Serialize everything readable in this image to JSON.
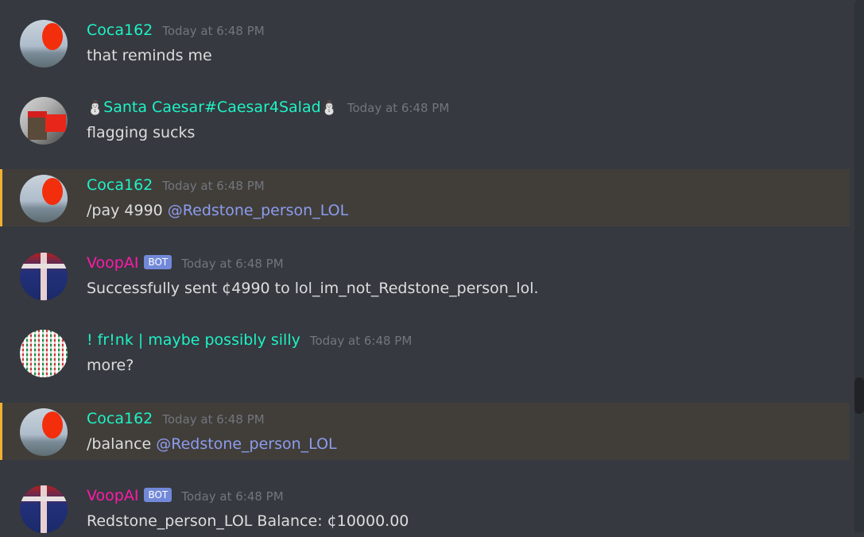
{
  "messages": [
    {
      "author": "Coca162",
      "time": "Today at 6:48 PM",
      "text": "that reminds me",
      "avatar": "coca",
      "highlight": false
    },
    {
      "author": "Santa Caesar#Caesar4Salad",
      "author_prefix": "⛄",
      "author_suffix": "⛄",
      "time": "Today at 6:48 PM",
      "text": "flagging sucks",
      "avatar": "santa",
      "highlight": false
    },
    {
      "author": "Coca162",
      "time": "Today at 6:48 PM",
      "text": "/pay 4990 ",
      "mention": "@Redstone_person_LOL",
      "avatar": "coca",
      "highlight": true
    },
    {
      "author": "VoopAI",
      "badge": "BOT",
      "time": "Today at 6:48 PM",
      "text": "Successfully sent ¢4990 to lol_im_not_Redstone_person_lol.",
      "avatar": "voop",
      "highlight": false
    },
    {
      "author": "! fr!nk | maybe possibly silly",
      "time": "Today at 6:48 PM",
      "text": "more?",
      "avatar": "frink",
      "highlight": false
    },
    {
      "author": "Coca162",
      "time": "Today at 6:48 PM",
      "text": "/balance ",
      "mention": "@Redstone_person_LOL",
      "avatar": "coca",
      "highlight": true
    },
    {
      "author": "VoopAI",
      "badge": "BOT",
      "time": "Today at 6:48 PM",
      "text": "Redstone_person_LOL Balance: ¢10000.00",
      "avatar": "voop",
      "highlight": false
    }
  ],
  "colors": {
    "background": "#36393f",
    "highlight": "#413e3a",
    "highlight_bar": "#f0b132",
    "name_teal": "#1ef2c6",
    "name_bot": "#ff1aa8",
    "mention": "#8c9cee",
    "badge": "#7289da"
  }
}
